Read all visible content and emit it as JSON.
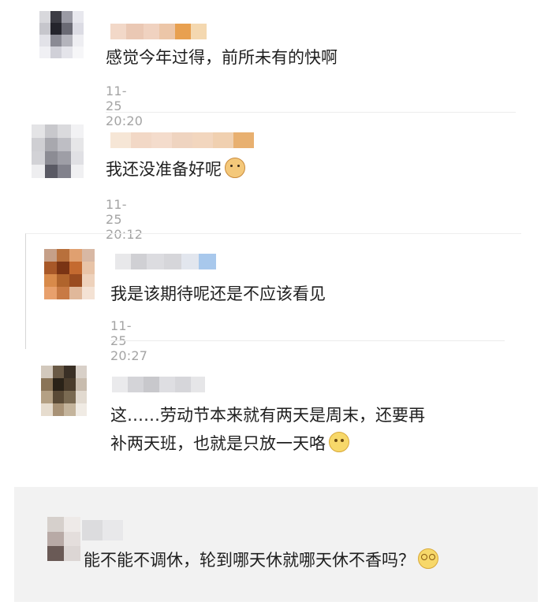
{
  "comments": [
    {
      "text": "感觉今年过得，前所未有的快啊",
      "time": "11-25 20:20"
    },
    {
      "text": "我还没准备好呢",
      "time": "11-25 20:12",
      "emoji": "cat-face-icon"
    },
    {
      "text": "我是该期待呢还是不应该看见",
      "time": "11-25 20:27"
    },
    {
      "line1": "这……劳动节本来就有两天是周末，还要再",
      "line2": "补两天班，也就是只放一天咯",
      "emoji": "sad-face-icon"
    },
    {
      "text": "能不能不调休，轮到哪天休就哪天休不香吗？",
      "emoji": "dizzy-face-icon"
    }
  ]
}
